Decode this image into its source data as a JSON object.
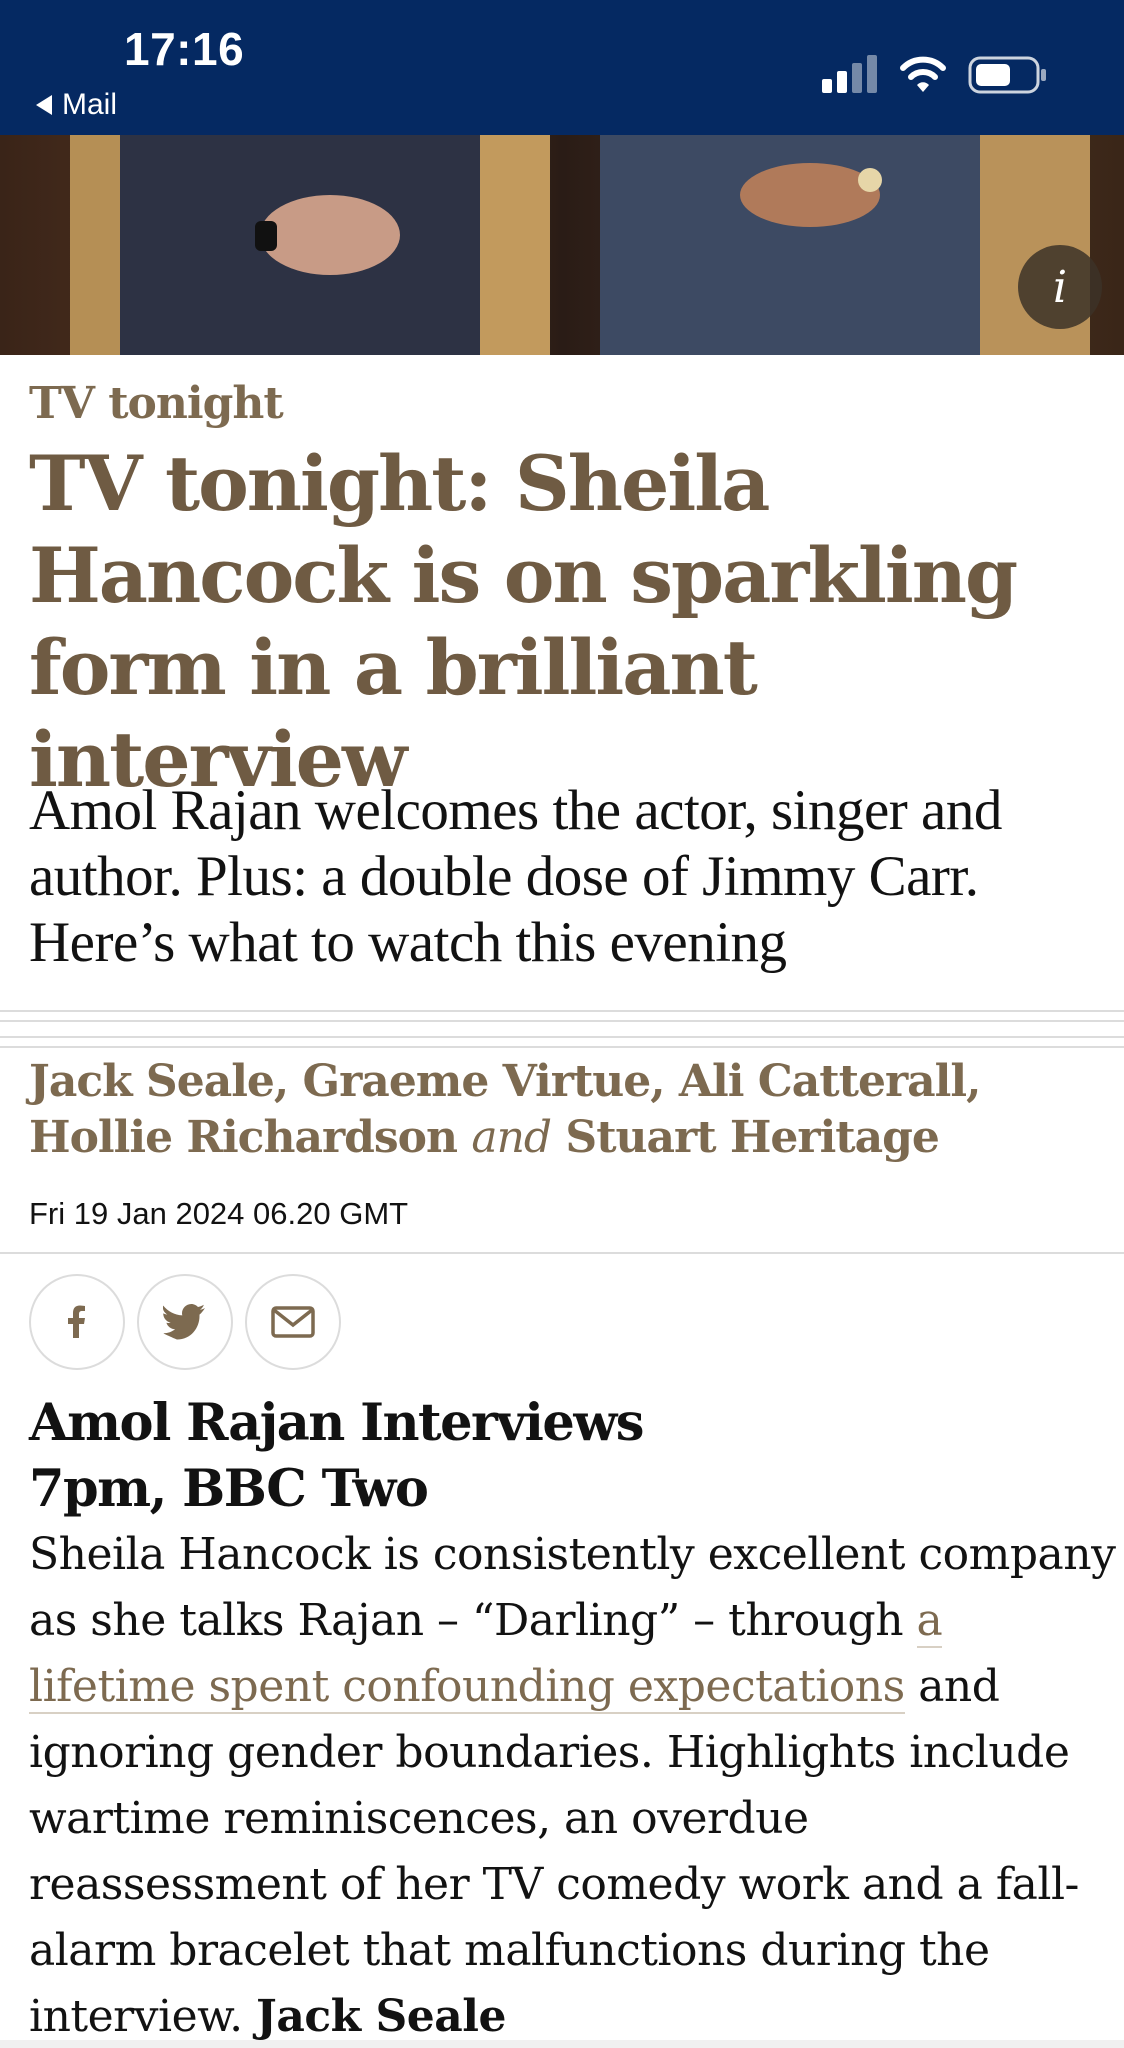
{
  "status_bar": {
    "time": "17:16",
    "back_label": "Mail",
    "icons": [
      "signal-icon",
      "wifi-icon",
      "battery-icon"
    ],
    "background": "#052962"
  },
  "hero": {
    "info_label": "i"
  },
  "article": {
    "kicker": "TV tonight",
    "headline": "TV tonight: Sheila Hancock is on sparkling form in a brilliant interview",
    "standfirst": "Amol Rajan welcomes the actor, singer and author. Plus: a double dose of Jimmy Carr. Here’s what to watch this evening",
    "byline": {
      "authors_first": "Jack Seale, Graeme Virtue, Ali Catterall, Hollie Richardson",
      "conjunction": "and",
      "author_last": "Stuart Heritage"
    },
    "dateline": "Fri 19 Jan 2024 06.20 GMT",
    "share": [
      "facebook-icon",
      "twitter-icon",
      "email-icon"
    ],
    "accent_color": "#7d6a50"
  },
  "listing": {
    "title_line1": "Amol Rajan Interviews",
    "title_line2": "7pm, BBC Two",
    "body_before_link": "Sheila Hancock is consistently excellent company as she talks Rajan – “Darling” – through ",
    "link_text": "a lifetime spent confounding expectations",
    "body_after_link": " and ignoring gender boundaries. Highlights include wartime reminiscences, an overdue reassessment of her TV comedy work and a fall-alarm bracelet that malfunctions during the interview. ",
    "author": "Jack Seale"
  }
}
